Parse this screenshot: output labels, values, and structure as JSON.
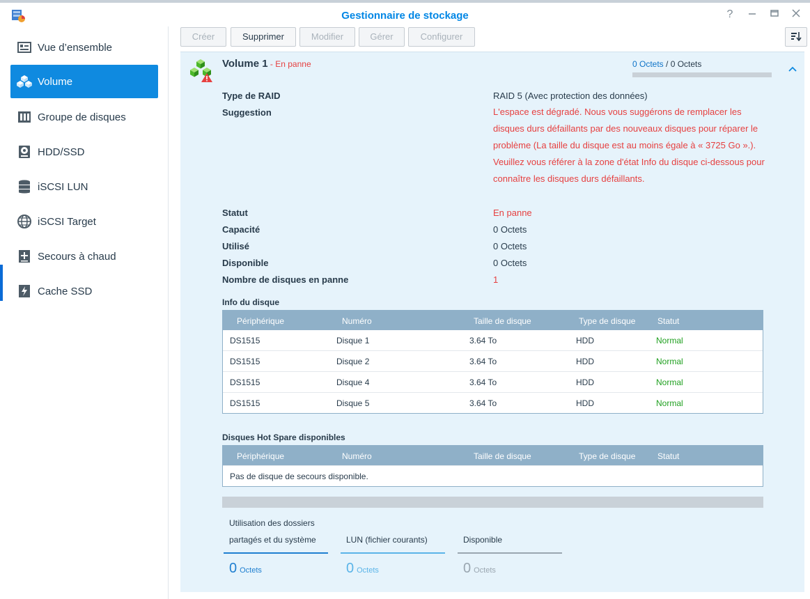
{
  "window": {
    "title": "Gestionnaire de stockage",
    "controls": [
      "help-icon",
      "minimize-icon",
      "maximize-icon",
      "close-icon"
    ]
  },
  "sidebar": {
    "items": [
      {
        "label": "Vue d’ensemble",
        "icon": "overview-icon",
        "active": false
      },
      {
        "label": "Volume",
        "icon": "cubes-icon",
        "active": true
      },
      {
        "label": "Groupe de disques",
        "icon": "disk-group-icon",
        "active": false
      },
      {
        "label": "HDD/SSD",
        "icon": "hdd-icon",
        "active": false
      },
      {
        "label": "iSCSI LUN",
        "icon": "database-icon",
        "active": false
      },
      {
        "label": "iSCSI Target",
        "icon": "globe-icon",
        "active": false
      },
      {
        "label": "Secours à chaud",
        "icon": "plus-box-icon",
        "active": false
      },
      {
        "label": "Cache SSD",
        "icon": "lightning-icon",
        "active": false
      }
    ]
  },
  "toolbar": {
    "create": "Créer",
    "delete": "Supprimer",
    "edit": "Modifier",
    "manage": "Gérer",
    "configure": "Configurer",
    "sort_icon": "sort-icon"
  },
  "volume": {
    "name": "Volume 1",
    "separator": " - ",
    "state": "En panne",
    "usage_used": "0 Octets",
    "usage_sep": " / ",
    "usage_total": "0 Octets",
    "usage_fraction": 0,
    "props": {
      "raid_type_label": "Type de RAID",
      "raid_type_value": "RAID 5 (Avec protection des données)",
      "suggestion_label": "Suggestion",
      "suggestion_value": "L'espace est dégradé. Nous vous suggérons de remplacer les disques durs défaillants par des nouveaux disques pour réparer le problème (La taille du disque est au moins égale à « 3725 Go ».). Veuillez vous référer à la zone d'état Info du disque ci-dessous pour connaître les disques durs défaillants.",
      "status_label": "Statut",
      "status_value": "En panne",
      "capacity_label": "Capacité",
      "capacity_value": "0 Octets",
      "used_label": "Utilisé",
      "used_value": "0 Octets",
      "available_label": "Disponible",
      "available_value": "0 Octets",
      "failed_label": "Nombre de disques en panne",
      "failed_value": "1"
    }
  },
  "disk_info": {
    "title": "Info du disque",
    "columns": [
      "Périphérique",
      "Numéro",
      "Taille de disque",
      "Type de disque",
      "Statut"
    ],
    "rows": [
      [
        "DS1515",
        "Disque 1",
        "3.64 To",
        "HDD",
        "Normal"
      ],
      [
        "DS1515",
        "Disque 2",
        "3.64 To",
        "HDD",
        "Normal"
      ],
      [
        "DS1515",
        "Disque 4",
        "3.64 To",
        "HDD",
        "Normal"
      ],
      [
        "DS1515",
        "Disque 5",
        "3.64 To",
        "HDD",
        "Normal"
      ]
    ]
  },
  "hot_spare": {
    "title": "Disques Hot Spare disponibles",
    "columns": [
      "Périphérique",
      "Numéro",
      "Taille de disque",
      "Type de disque",
      "Statut"
    ],
    "empty_text": "Pas de disque de secours disponible."
  },
  "summary": {
    "shared": {
      "label": "Utilisation des dossiers partagés et du système",
      "value": "0",
      "unit": "Octets",
      "color": "#1f7fd0"
    },
    "lun": {
      "label": "LUN (fichier courants)",
      "value": "0",
      "unit": "Octets",
      "color": "#5ab4e8"
    },
    "available": {
      "label": "Disponible",
      "value": "0",
      "unit": "Octets",
      "color": "#9aa6b0"
    }
  },
  "colors": {
    "accent": "#0f8ae0",
    "error": "#e64040",
    "ok": "#20a020",
    "grid_header": "#8fb0c8",
    "panel": "#e6f3fb"
  }
}
